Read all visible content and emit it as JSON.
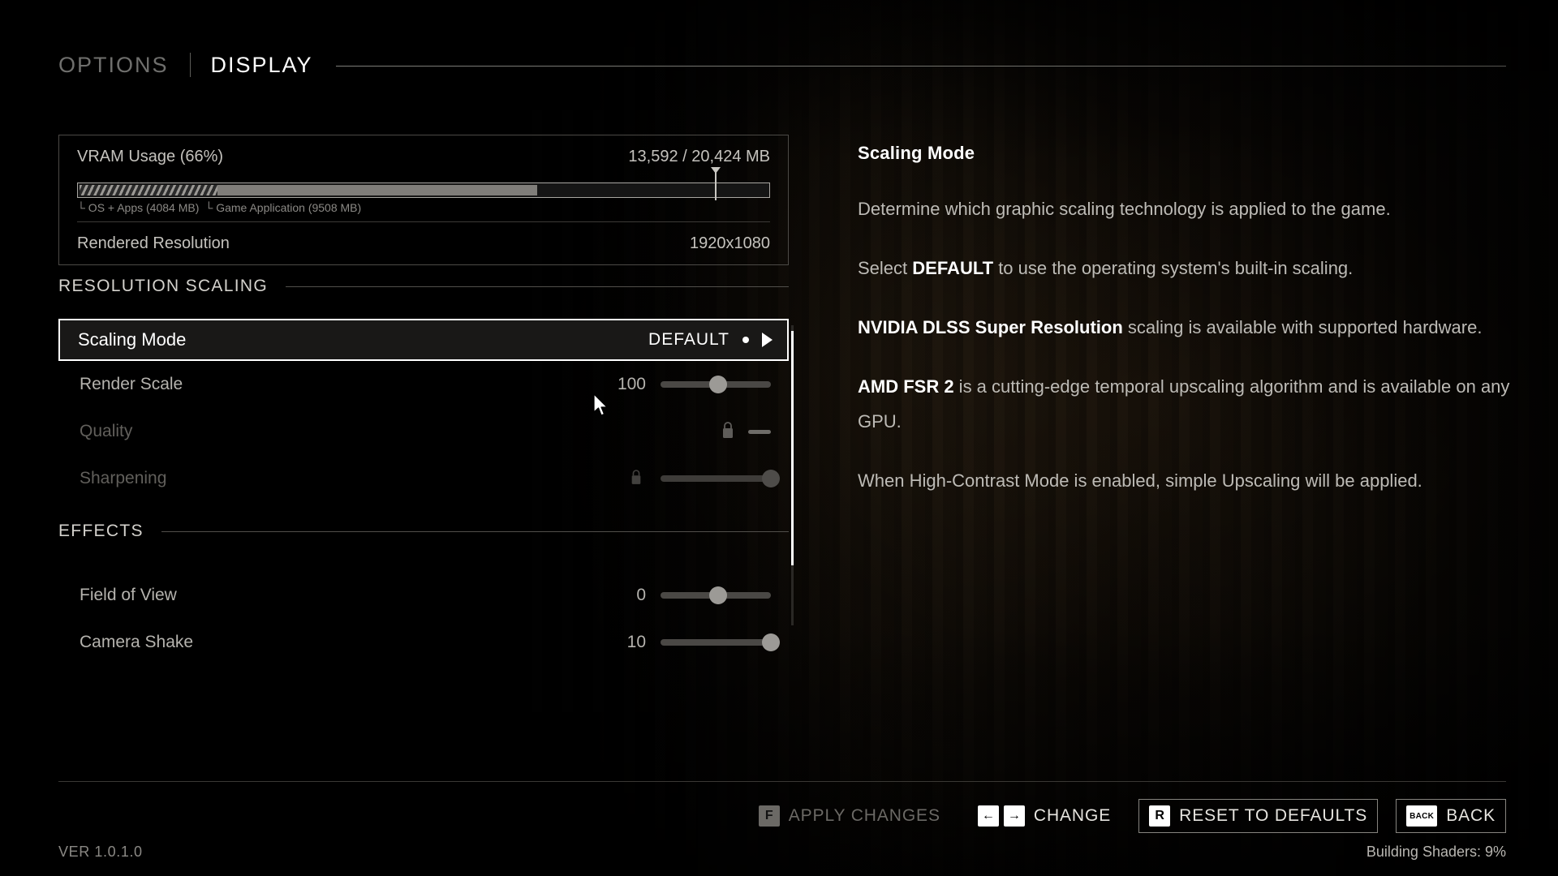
{
  "header": {
    "tab_inactive": "OPTIONS",
    "tab_active": "DISPLAY"
  },
  "vram": {
    "label": "VRAM Usage (66%)",
    "value": "13,592 / 20,424 MB",
    "percent": 66,
    "os_apps_legend": "└ OS + Apps (4084 MB)",
    "game_legend": "└ Game Application (9508 MB)",
    "os_apps_mb": 4084,
    "game_mb": 9508,
    "total_mb": 20424,
    "used_mb": 13592,
    "resolution_label": "Rendered Resolution",
    "resolution_value": "1920x1080"
  },
  "sections": {
    "resolution_scaling": "RESOLUTION SCALING",
    "effects": "EFFECTS"
  },
  "options": {
    "scaling_mode": {
      "label": "Scaling Mode",
      "value": "DEFAULT"
    },
    "render_scale": {
      "label": "Render Scale",
      "value": "100",
      "fill_percent": 52
    },
    "quality": {
      "label": "Quality",
      "value": ""
    },
    "sharpening": {
      "label": "Sharpening",
      "value": "",
      "fill_percent": 100
    },
    "field_of_view": {
      "label": "Field of View",
      "value": "0",
      "fill_percent": 52
    },
    "camera_shake": {
      "label": "Camera Shake",
      "value": "10",
      "fill_percent": 100
    }
  },
  "description": {
    "title": "Scaling Mode",
    "p1": "Determine which graphic scaling technology is applied to the game.",
    "p2_pre": "Select ",
    "p2_bold": "DEFAULT",
    "p2_post": " to use the operating system's built-in scaling.",
    "p3_bold": "NVIDIA DLSS Super Resolution",
    "p3_post": " scaling is available with supported hardware.",
    "p4_bold": "AMD FSR 2",
    "p4_post": " is a cutting-edge temporal upscaling algorithm and is available on any GPU.",
    "p5": "When High-Contrast Mode is enabled, simple Upscaling will be applied."
  },
  "footer": {
    "apply": {
      "key": "F",
      "label": "APPLY CHANGES"
    },
    "change": {
      "key_left": "←",
      "key_right": "→",
      "label": "CHANGE"
    },
    "reset": {
      "key": "R",
      "label": "RESET TO DEFAULTS"
    },
    "back": {
      "key": "BACK",
      "label": "BACK"
    }
  },
  "status": {
    "version": "VER 1.0.1.0",
    "shaders": "Building Shaders: 9%"
  },
  "colors": {
    "accent": "#ffffff",
    "text": "#bdbbb6",
    "dim": "#615f5b",
    "bar_game": "#807e7a"
  }
}
